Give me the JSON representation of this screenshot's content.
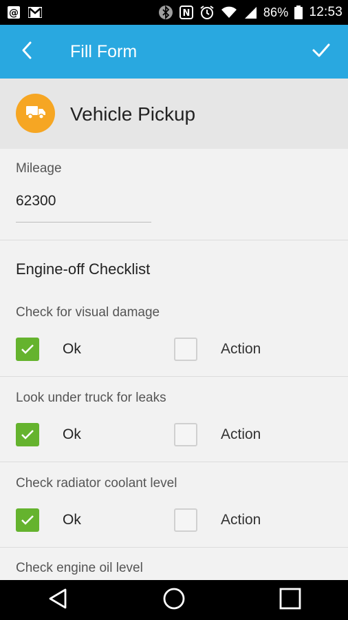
{
  "status_bar": {
    "battery": "86%",
    "time": "12:53",
    "icons": [
      "email-at-icon",
      "gmail-icon",
      "bluetooth-icon",
      "nfc-icon",
      "alarm-icon",
      "wifi-icon",
      "signal-icon",
      "battery-icon"
    ]
  },
  "app_bar": {
    "title": "Fill Form",
    "back_icon": "back-chevron-icon",
    "confirm_icon": "checkmark-icon",
    "color": "#29a8e0"
  },
  "form": {
    "title": "Vehicle Pickup",
    "icon": "truck-icon",
    "icon_bg": "#f6a623"
  },
  "mileage": {
    "label": "Mileage",
    "value": "62300"
  },
  "checklist": {
    "title": "Engine-off Checklist",
    "ok_label": "Ok",
    "action_label": "Action",
    "check_color": "#65b32e",
    "items": [
      {
        "question": "Check for visual damage",
        "ok": true,
        "action": false
      },
      {
        "question": "Look under truck for leaks",
        "ok": true,
        "action": false
      },
      {
        "question": "Check radiator coolant level",
        "ok": true,
        "action": false
      },
      {
        "question": "Check engine oil level"
      }
    ]
  },
  "nav_bar": {
    "back": "nav-back-icon",
    "home": "nav-home-icon",
    "recents": "nav-recents-icon"
  }
}
